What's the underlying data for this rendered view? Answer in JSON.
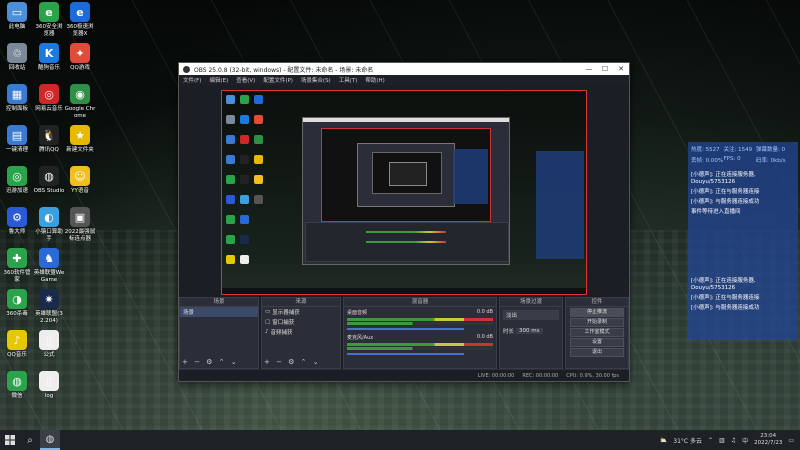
{
  "desktop_icons": [
    {
      "label": "此电脑",
      "color": "#4a8fd8",
      "glyph": "▭"
    },
    {
      "label": "360安全浏览器",
      "color": "#2aa34a",
      "glyph": "e"
    },
    {
      "label": "360极速浏览器X",
      "color": "#1e6ad8",
      "glyph": "e"
    },
    {
      "label": "回收站",
      "color": "#7a8a9a",
      "glyph": "♲"
    },
    {
      "label": "酷狗音乐",
      "color": "#1a7ae0",
      "glyph": "K"
    },
    {
      "label": "QQ游戏",
      "color": "#e24a3a",
      "glyph": "✦"
    },
    {
      "label": "控制面板",
      "color": "#3a7ad0",
      "glyph": "▦"
    },
    {
      "label": "网易云音乐",
      "color": "#d02828",
      "glyph": "◎"
    },
    {
      "label": "Google Chrome",
      "color": "#2f8f46",
      "glyph": "◉"
    },
    {
      "label": "一键清理",
      "color": "#3a7ad0",
      "glyph": "▤"
    },
    {
      "label": "腾讯QQ",
      "color": "#222",
      "glyph": "🐧"
    },
    {
      "label": "新建文件夹",
      "color": "#e6b800",
      "glyph": "★"
    },
    {
      "label": "迅游加速",
      "color": "#2aa34a",
      "glyph": "◎"
    },
    {
      "label": "OBS Studio",
      "color": "#222",
      "glyph": "◍"
    },
    {
      "label": "YY语音",
      "color": "#f0c020",
      "glyph": "☺"
    },
    {
      "label": "鲁大师",
      "color": "#2a5ad8",
      "glyph": "⚙"
    },
    {
      "label": "小猿口算助手",
      "color": "#3aa0e0",
      "glyph": "◐"
    },
    {
      "label": "2022最强鼠标连点器",
      "color": "#555",
      "glyph": "▣"
    },
    {
      "label": "360软件管家",
      "color": "#2aa34a",
      "glyph": "✚"
    },
    {
      "label": "英雄联盟WeGame",
      "color": "#2a6ad8",
      "glyph": "♞"
    },
    {
      "label": "",
      "color": "transparent",
      "glyph": ""
    },
    {
      "label": "360杀毒",
      "color": "#2aa34a",
      "glyph": "◑"
    },
    {
      "label": "英雄联盟(32.204)",
      "color": "#1a2a4a",
      "glyph": "✷"
    },
    {
      "label": "",
      "color": "transparent",
      "glyph": ""
    },
    {
      "label": "QQ音乐",
      "color": "#e6c800",
      "glyph": "♪"
    },
    {
      "label": "公式",
      "color": "#eee",
      "glyph": "▯"
    },
    {
      "label": "",
      "color": "transparent",
      "glyph": ""
    },
    {
      "label": "微信",
      "color": "#2aa34a",
      "glyph": "◍"
    },
    {
      "label": "log",
      "color": "#eee",
      "glyph": "▯"
    }
  ],
  "obs": {
    "title": "OBS 25.0.8 (32-bit, windows) - 配置文件: 未命名 - 场景: 未命名",
    "minimize": "—",
    "maximize": "☐",
    "close": "✕",
    "menu": [
      "文件(F)",
      "编辑(E)",
      "查看(V)",
      "配置文件(P)",
      "场景集合(S)",
      "工具(T)",
      "帮助(H)"
    ],
    "docks": {
      "scenes": {
        "header": "场景",
        "items": [
          "场景"
        ]
      },
      "sources": {
        "header": "来源",
        "items": [
          "显示器捕获",
          "窗口捕获",
          "音频捕获"
        ]
      },
      "mixer": {
        "header": "混音器",
        "tracks": [
          {
            "name": "桌面音频",
            "db": "0.0 dB"
          },
          {
            "name": "麦克风/Aux",
            "db": "0.0 dB"
          }
        ]
      },
      "transitions": {
        "header": "场景过渡",
        "type": "淡出",
        "duration_label": "时长",
        "duration": "300 ms"
      },
      "controls": {
        "header": "控件",
        "buttons": [
          "停止推流",
          "开始录制",
          "工作室模式",
          "设置",
          "退出"
        ]
      }
    },
    "status": {
      "live": "LIVE: 00:00:00",
      "rec": "REC: 00:00:00",
      "cpu": "CPU: 0.9%, 30.00 fps"
    },
    "dock_tools": "+ − ⚙ ⌃ ⌄"
  },
  "overlay": {
    "stats": [
      {
        "k": "热度:",
        "v": "5527"
      },
      {
        "k": "关注:",
        "v": "1549"
      },
      {
        "k": "弹幕数量:",
        "v": "0"
      },
      {
        "k": "丢帧:",
        "v": "0.00%"
      },
      {
        "k": "FPS:",
        "v": "0"
      },
      {
        "k": "码率:",
        "v": "0kb/s"
      }
    ],
    "messages_top": [
      "[小德声]: 正在连接服务器, Douyu/5753126",
      "[小德声]: 正在与服务器连接",
      "[小德声]: 与服务器连接成功",
      "事件等待进入直播间"
    ],
    "messages_bottom": [
      "[小德声]: 正在连接服务器, Douyu/5753126",
      "[小德声]: 正在与服务器连接",
      "[小德声]: 与服务器连接成功"
    ]
  },
  "taskbar": {
    "weather": "31°C 多云",
    "time": "23:04",
    "date": "2022/7/23",
    "lang": "中"
  }
}
